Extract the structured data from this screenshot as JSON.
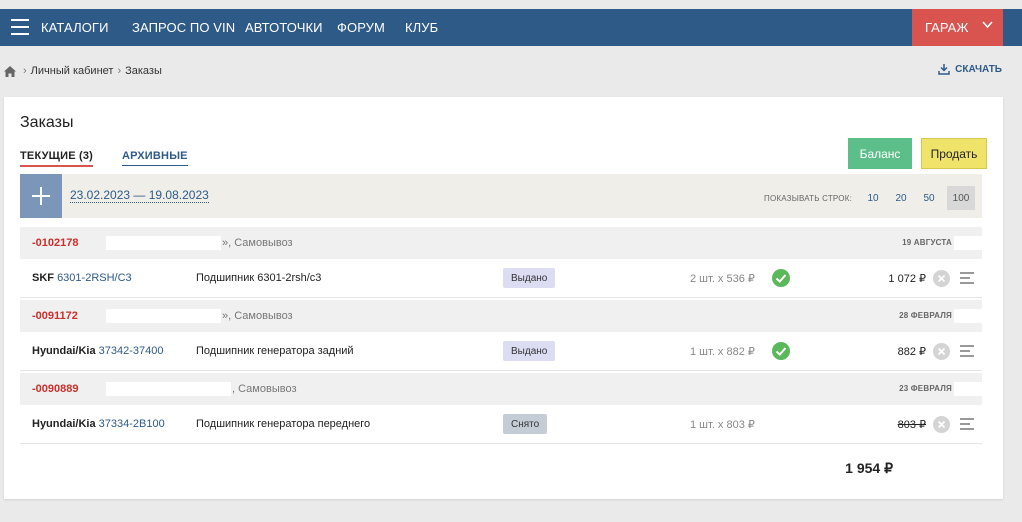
{
  "nav": {
    "items": [
      "КАТАЛОГИ",
      "ЗАПРОС ПО VIN",
      "АВТОТОЧКИ",
      "ФОРУМ",
      "КЛУБ"
    ],
    "garage_label": "ГАРАЖ"
  },
  "breadcrumb": {
    "items": [
      "Личный кабинет",
      "Заказы"
    ]
  },
  "download_label": "СКАЧАТЬ",
  "page": {
    "title": "Заказы",
    "tabs": {
      "current": "ТЕКУЩИЕ (3)",
      "archive": "АРХИВНЫЕ"
    },
    "buttons": {
      "balance": "Баланс",
      "sell": "Продать"
    }
  },
  "filter": {
    "date_range": "23.02.2023 — 19.08.2023",
    "rows_label": "ПОКАЗЫВАТЬ СТРОК:",
    "rows_options": [
      "10",
      "20",
      "50",
      "100"
    ],
    "rows_selected": "100"
  },
  "orders": [
    {
      "number": "-0102178",
      "delivery": "», Самовывоз",
      "date": "19 АВГУСТА",
      "item": {
        "brand": "SKF",
        "article": "6301-2RSH/C3",
        "name": "Подшипник 6301-2rsh/c3",
        "status": "Выдано",
        "qty": "2 шт. x 536 ₽",
        "total": "1 072 ₽"
      }
    },
    {
      "number": "-0091172",
      "delivery": "», Самовывоз",
      "date": "28 ФЕВРАЛЯ",
      "item": {
        "brand": "Hyundai/Kia",
        "article": "37342-37400",
        "name": "Подшипник генератора задний",
        "status": "Выдано",
        "qty": "1 шт. x 882 ₽",
        "total": "882 ₽"
      }
    },
    {
      "number": "-0090889",
      "delivery": ", Самовывоз",
      "date": "23 ФЕВРАЛЯ",
      "item": {
        "brand": "Hyundai/Kia",
        "article": "37334-2B100",
        "name": "Подшипник генератора переднего",
        "status": "Снято",
        "qty": "1 шт. x 803 ₽",
        "total": "803 ₽"
      }
    }
  ],
  "grand_total": "1 954 ₽",
  "colors": {
    "nav": "#2e5a88",
    "garage": "#d9534f",
    "balance": "#5cbf8a",
    "sell": "#f0e36a",
    "order_number": "#c9302c"
  }
}
